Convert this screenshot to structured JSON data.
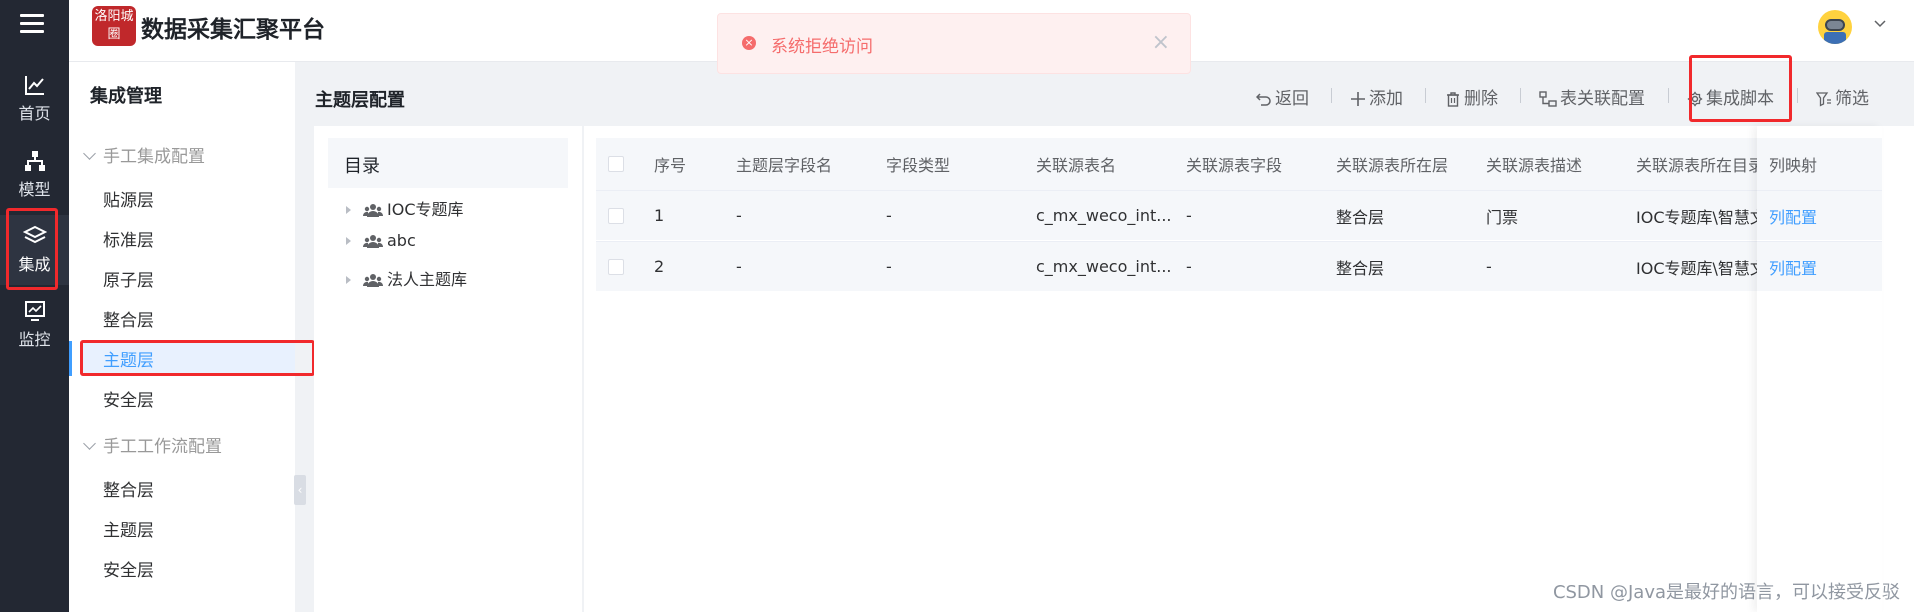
{
  "app": {
    "title": "数据采集汇聚平台",
    "logo_text": "洛阳城圈"
  },
  "rail": {
    "items": [
      {
        "label": "首页",
        "icon": "line-chart-icon"
      },
      {
        "label": "模型",
        "icon": "hierarchy-icon"
      },
      {
        "label": "集成",
        "icon": "layers-icon",
        "active": true
      },
      {
        "label": "监控",
        "icon": "monitor-icon"
      }
    ]
  },
  "toast": {
    "message": "系统拒绝访问",
    "close": "×"
  },
  "subnav": {
    "header": "集成管理",
    "groups": [
      {
        "label": "手工集成配置",
        "items": [
          "贴源层",
          "标准层",
          "原子层",
          "整合层",
          "主题层",
          "安全层"
        ]
      },
      {
        "label": "手工工作流配置",
        "items": [
          "整合层",
          "主题层",
          "安全层"
        ]
      }
    ],
    "active": "主题层",
    "collapse_glyph": "‹"
  },
  "main": {
    "title": "主题层配置",
    "toolbar": {
      "back": "返回",
      "add": "添加",
      "delete": "删除",
      "relation": "表关联配置",
      "script": "集成脚本",
      "filter": "筛选"
    }
  },
  "tree": {
    "header": "目录",
    "nodes": [
      "IOC专题库",
      "abc",
      "法人主题库"
    ]
  },
  "table": {
    "columns": [
      "序号",
      "主题层字段名",
      "字段类型",
      "关联源表名",
      "关联源表字段",
      "关联源表所在层",
      "关联源表描述",
      "关联源表所在目录",
      "列映射"
    ],
    "rows": [
      {
        "index": "1",
        "field": "-",
        "type": "-",
        "source_table": "c_mx_weco_int...",
        "source_field": "-",
        "layer": "整合层",
        "desc": "门票",
        "catalog": "IOC专题库\\智慧文旅",
        "action": "列配置"
      },
      {
        "index": "2",
        "field": "-",
        "type": "-",
        "source_table": "c_mx_weco_int...",
        "source_field": "-",
        "layer": "整合层",
        "desc": "-",
        "catalog": "IOC专题库\\智慧文旅",
        "action": "列配置"
      }
    ]
  },
  "watermark": "CSDN @Java是最好的语言，可以接受反驳",
  "colors": {
    "rail_bg": "#232833",
    "accent": "#409eff",
    "error": "#f56c6c",
    "highlight": "#f1292c"
  }
}
